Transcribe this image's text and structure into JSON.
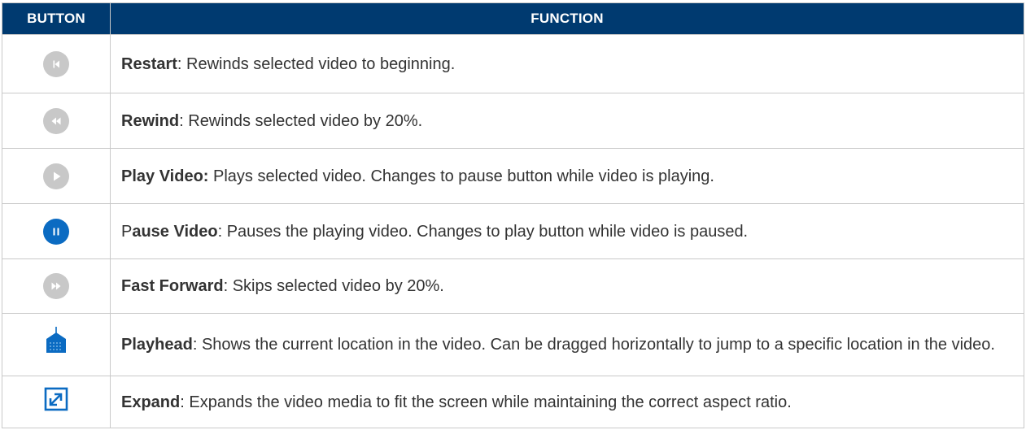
{
  "table": {
    "headers": {
      "button": "BUTTON",
      "function": "FUNCTION"
    },
    "rows": [
      {
        "icon": "restart-icon",
        "name": "Restart",
        "sep": ":",
        "desc": " Rewinds selected video to beginning."
      },
      {
        "icon": "rewind-icon",
        "name": "Rewind",
        "sep": ":",
        "desc": " Rewinds selected video by 20%."
      },
      {
        "icon": "play-icon",
        "name": "Play Video:",
        "sep": "",
        "desc": " Plays selected video. Changes to pause button while video is playing."
      },
      {
        "icon": "pause-icon",
        "name_prefix": "P",
        "name": "ause Video",
        "sep": ":",
        "desc": " Pauses the playing video. Changes to play button while video is paused."
      },
      {
        "icon": "fast-forward-icon",
        "name": "Fast Forward",
        "sep": ":",
        "desc": " Skips selected video by 20%."
      },
      {
        "icon": "playhead-icon",
        "name": "Playhead",
        "sep": ":",
        "desc": " Shows the current location in the video. Can be dragged horizontally to jump to a specific location in the video."
      },
      {
        "icon": "expand-icon",
        "name": "Expand",
        "sep": ":",
        "desc": " Expands the video media to fit the screen while maintaining the correct aspect ratio."
      }
    ]
  },
  "colors": {
    "header_bg": "#003a70",
    "icon_gray": "#c8c8c8",
    "icon_blue": "#0b6bc2",
    "border": "#c9c9c9"
  }
}
